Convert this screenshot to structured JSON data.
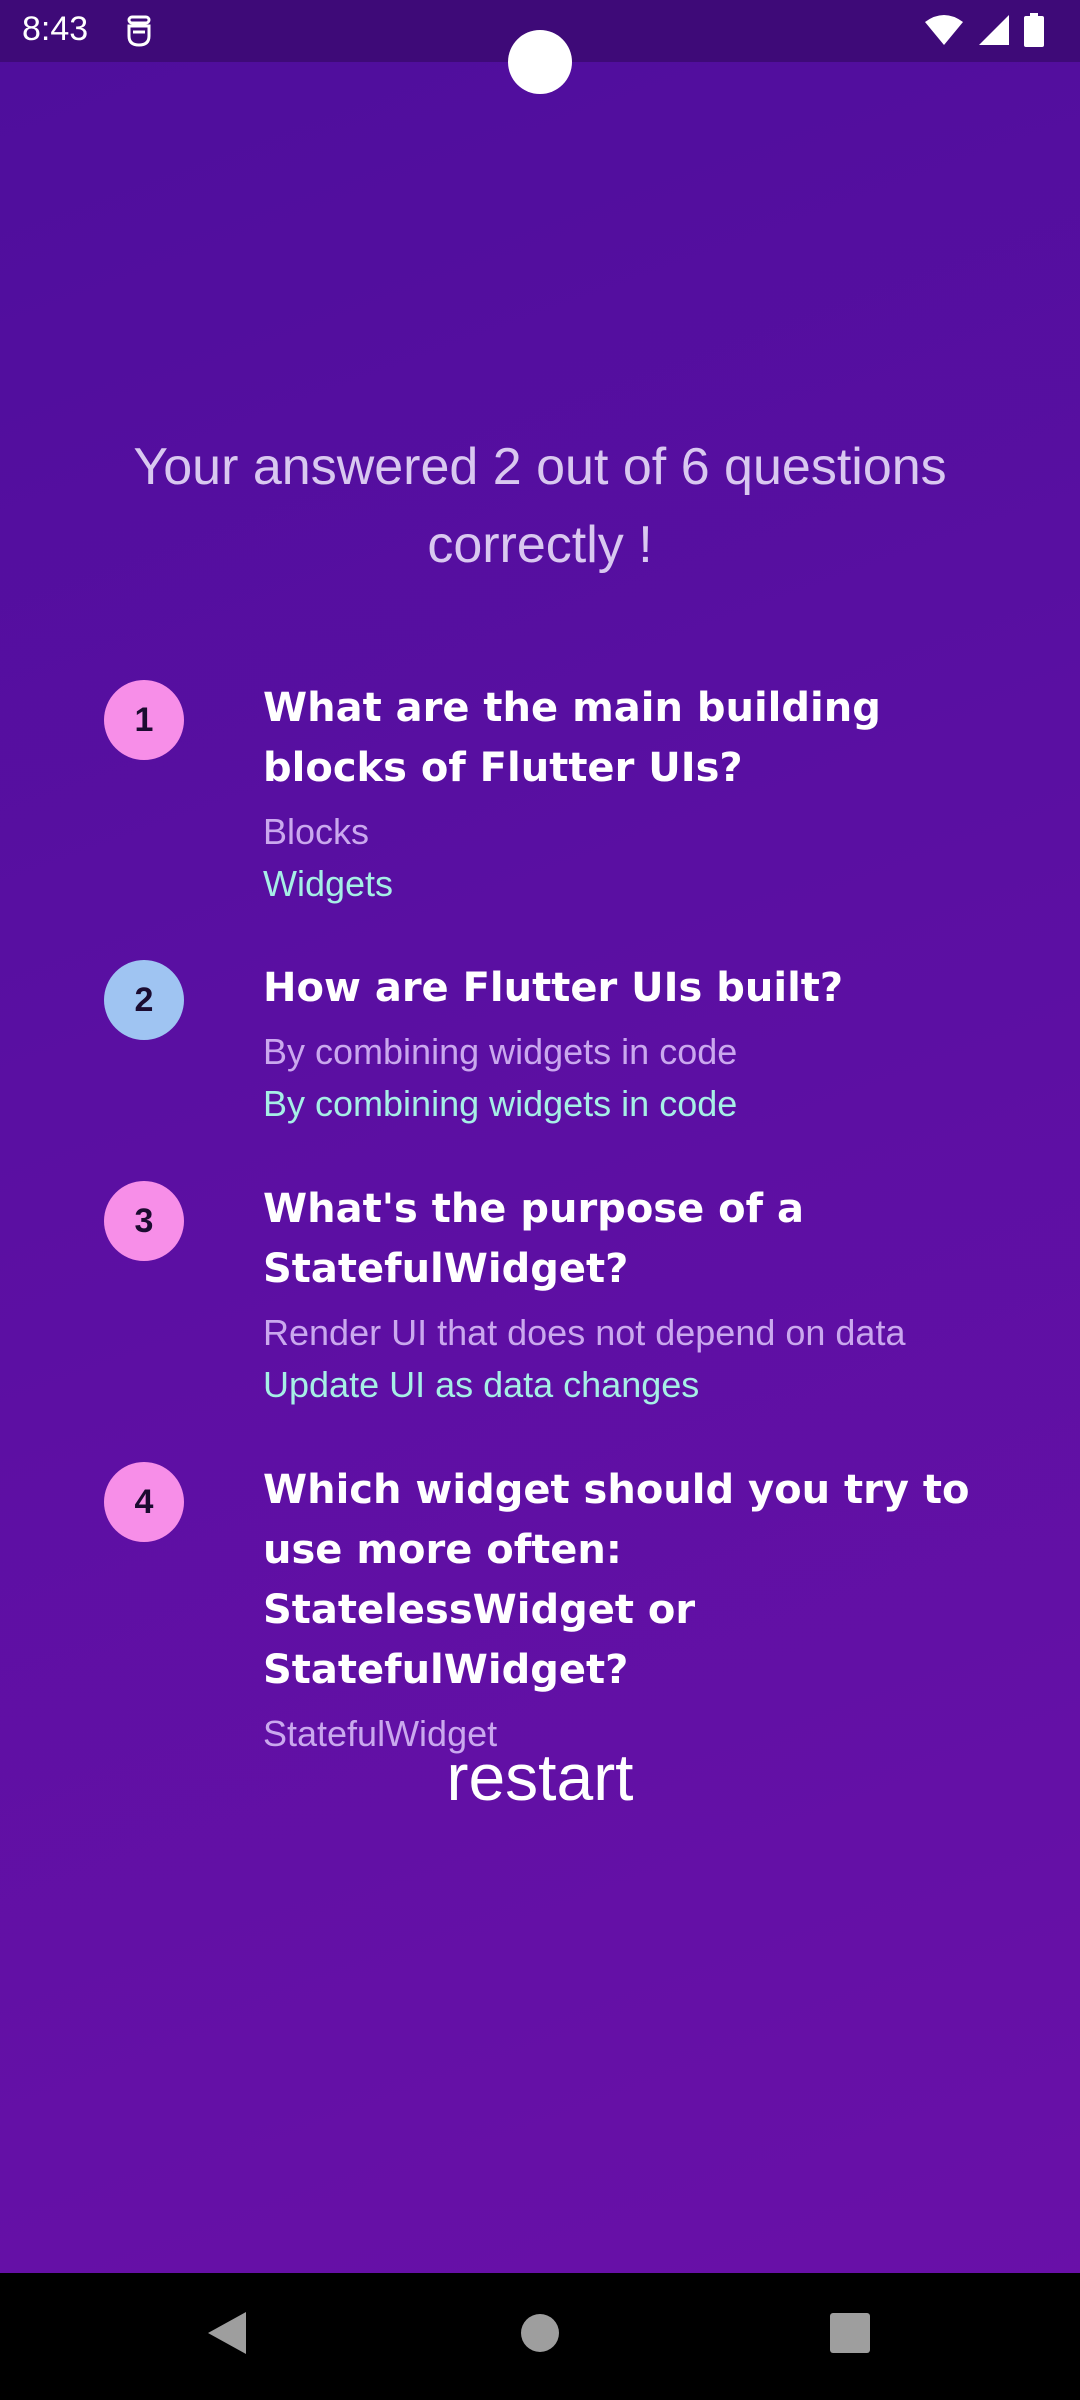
{
  "status_bar": {
    "time": "8:43"
  },
  "summary": {
    "heading": "Your answered 2 out of 6 questions correctly !"
  },
  "items": [
    {
      "index": "1",
      "question": "What are the main building blocks of Flutter UIs?",
      "user_answer": "Blocks",
      "correct_answer": "Widgets",
      "badge_color": "#f78ee8"
    },
    {
      "index": "2",
      "question": "How are Flutter UIs built?",
      "user_answer": "By combining widgets in code",
      "correct_answer": "By combining widgets in code",
      "badge_color": "#9fc4f2"
    },
    {
      "index": "3",
      "question": "What's the purpose of a StatefulWidget?",
      "user_answer": "Render UI that does not depend on data",
      "correct_answer": "Update UI as data changes",
      "badge_color": "#f78ee8"
    },
    {
      "index": "4",
      "question": "Which widget should you try to use more often: StatelessWidget or StatefulWidget?",
      "user_answer": "StatefulWidget",
      "correct_answer": "",
      "badge_color": "#f78ee8"
    }
  ],
  "restart": {
    "label": "restart"
  },
  "colors": {
    "background_top": "#4e0e9c",
    "background_bottom": "#6a10a8",
    "correct_answer": "#a6efe6",
    "user_answer": "#caa8ee"
  },
  "icons": {
    "wifi": "wifi-icon",
    "signal": "signal-icon",
    "battery": "battery-icon",
    "back": "back-icon",
    "home": "home-icon",
    "recents": "recents-icon"
  }
}
